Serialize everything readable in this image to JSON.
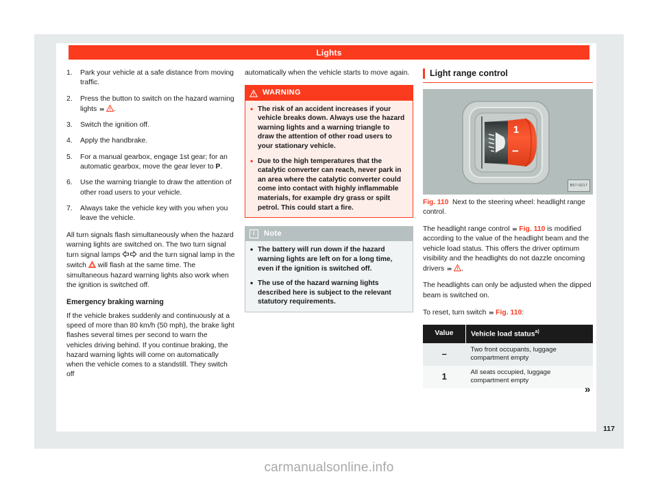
{
  "header": {
    "chapter": "Lights"
  },
  "page": {
    "number": "117",
    "continuation": "»",
    "watermark": "carmanualsonline.info"
  },
  "column_left": {
    "steps": [
      {
        "num": "1.",
        "text_before": "Park your vehicle at a safe distance from moving traffic.",
        "has_ref": false
      },
      {
        "num": "2.",
        "text_before": "Press the button to switch on the hazard warning lights ",
        "has_ref": true,
        "ref_icon": "warning-triangle",
        "text_after": "."
      },
      {
        "num": "3.",
        "text_before": "Switch the ignition off.",
        "has_ref": false
      },
      {
        "num": "4.",
        "text_before": "Apply the handbrake.",
        "has_ref": false
      },
      {
        "num": "5.",
        "text_before": "For a manual gearbox, engage 1st gear; for an automatic gearbox, move the gear lever to ",
        "has_ref": false,
        "bold_tail": "P",
        "text_after": "."
      },
      {
        "num": "6.",
        "text_before": "Use the warning triangle to draw the attention of other road users to your vehicle.",
        "has_ref": false
      },
      {
        "num": "7.",
        "text_before": "Always take the vehicle key with you when you leave the vehicle.",
        "has_ref": false
      }
    ],
    "para_flash_a": "All turn signals flash simultaneously when the hazard warning lights are switched on. The two turn signal turn signal lamps ",
    "para_flash_b": " and the turn signal lamp in the switch ",
    "para_flash_c": " will flash at the same time. The simultaneous hazard warning lights also work when the ignition is switched off.",
    "subheading": "Emergency braking warning",
    "para_braking": "If the vehicle brakes suddenly and continuously at a speed of more than 80 km/h (50 mph), the brake light flashes several times per second to warn the vehicles driving behind. If you continue braking, the hazard warning lights will come on automatically when the vehicle comes to a standstill. They switch off"
  },
  "column_mid": {
    "para_continued": "automatically when the vehicle starts to move again.",
    "warning": {
      "title": "WARNING",
      "icon": "warning-triangle-icon",
      "bullets": [
        "The risk of an accident increases if your vehicle breaks down. Always use the hazard warning lights and a warning triangle to draw the attention of other road users to your stationary vehicle.",
        "Due to the high temperatures that the catalytic converter can reach, never park in an area where the catalytic converter could come into contact with highly inflammable materials, for example dry grass or spilt petrol. This could start a fire."
      ]
    },
    "note": {
      "title": "Note",
      "icon": "info-icon",
      "icon_glyph": "i",
      "bullets": [
        "The battery will run down if the hazard warning lights are left on for a long time, even if the ignition is switched off.",
        "The use of the hazard warning lights described here is subject to the relevant statutory requirements."
      ]
    }
  },
  "column_right": {
    "section_title": "Light range control",
    "figure": {
      "code": "B57-0217",
      "knob_labels": {
        "top": "1",
        "bottom": "−"
      },
      "headlight_icon": "headlight-range-icon"
    },
    "caption_num": "Fig. 110",
    "caption_text": "Next to the steering wheel: headlight range control.",
    "para1_a": "The headlight range control ",
    "para1_ref": "Fig. 110",
    "para1_b": " is modified according to the value of the headlight beam and the vehicle load status. This offers the driver optimum visibility and the headlights do not dazzle oncoming drivers ",
    "para1_c": ".",
    "para2": "The headlights can only be adjusted when the dipped beam is switched on.",
    "para3_a": "To reset, turn switch ",
    "para3_ref": "Fig. 110",
    "para3_b": ":",
    "table": {
      "headers": {
        "value": "Value",
        "status": "Vehicle load status",
        "status_sup": "a)"
      },
      "rows": [
        {
          "value": "–",
          "status": "Two front occupants, luggage compartment empty"
        },
        {
          "value": "1",
          "status": "All seats occupied, luggage compartment empty"
        }
      ]
    }
  },
  "colors": {
    "accent_red": "#fb3b1e",
    "note_gray": "#b6c0c0",
    "page_gray": "#e6eaeb",
    "table_header": "#1b1b1b"
  }
}
